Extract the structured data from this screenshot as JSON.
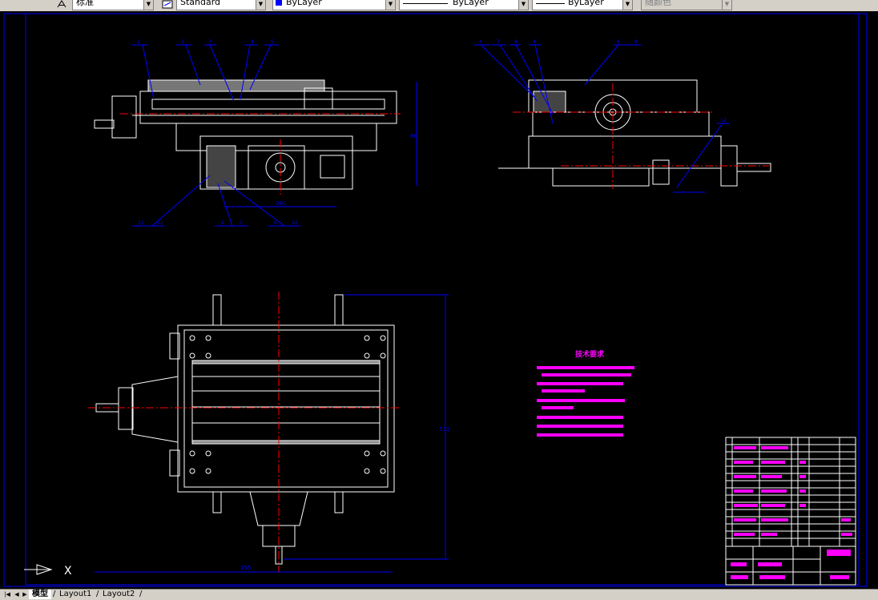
{
  "toolbar": {
    "text_style": "标准",
    "dim_style": "Standard",
    "layer_color": "ByLayer",
    "linetype": "ByLayer",
    "lineweight": "ByLayer",
    "plot_style": "随颜色",
    "layer_color_swatch": "#0000ff"
  },
  "drawing": {
    "background": "#000000",
    "frame_color": "#0000ff",
    "part_color": "#ffffff",
    "centerline_color": "#ff0000",
    "leader_color": "#0000ff",
    "notes_color": "#ff00ff",
    "title_block_color": "#ffffff",
    "title_block_fill_color": "#ff00ff",
    "notes_title": "技术要求",
    "callouts_view1": [
      "1",
      "2",
      "3",
      "4",
      "5",
      "11",
      "11",
      "6",
      "5",
      "6",
      "10"
    ],
    "callouts_view2": [
      "4",
      "7",
      "8",
      "4",
      "8",
      "9",
      "12"
    ],
    "dim_view1_width": "380",
    "dim_view1_height": "80",
    "dim_plan_width": "155",
    "dim_plan_height": "571"
  },
  "ucs_icon": {
    "x_label": "X"
  },
  "tabs": {
    "model": "模型",
    "layout1": "Layout1",
    "layout2": "Layout2"
  }
}
